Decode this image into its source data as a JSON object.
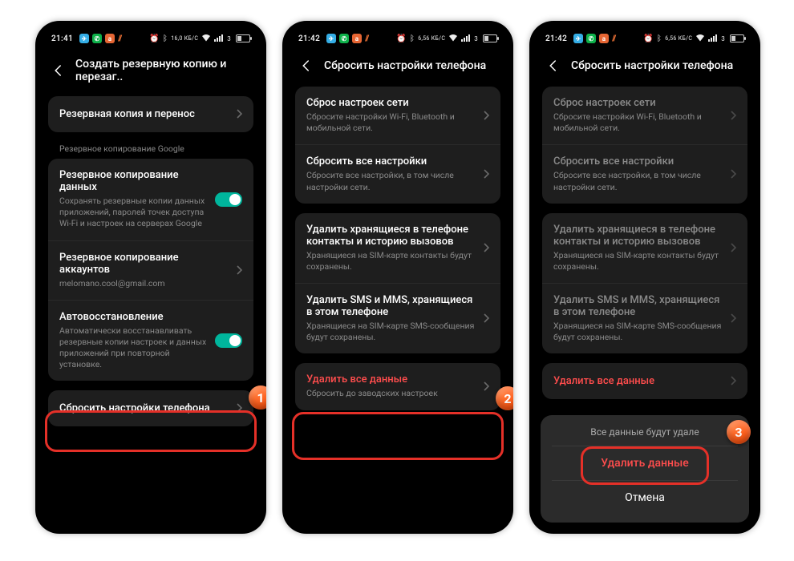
{
  "screens": {
    "s1": {
      "status": {
        "time": "21:41",
        "net": "16,0 КБ/С",
        "battery": "3"
      },
      "header": "Создать резервную копию и перезаг..",
      "row_backup_transfer": "Резервная копия и перенос",
      "section_google": "Резервное копирование Google",
      "row_data_backup": {
        "title": "Резервное копирование данных",
        "sub": "Сохранять резервные копии данных приложений, паролей точек доступа Wi-Fi и настроек на серверах Google"
      },
      "row_acct_backup": {
        "title": "Резервное копирование аккаунтов",
        "sub": "melomano.cool@gmail.com"
      },
      "row_autorestore": {
        "title": "Автовосстановление",
        "sub": "Автоматически восстанавливать резервные копии настроек и данных приложений при повторной установке."
      },
      "row_reset": "Сбросить настройки телефона",
      "badge": "1"
    },
    "s2": {
      "status": {
        "time": "21:42",
        "net": "6,56 КБ/С",
        "battery": "3"
      },
      "header": "Сбросить настройки телефона",
      "row_net": {
        "title": "Сброс настроек сети",
        "sub": "Сбросите настройки Wi-Fi, Bluetooth и мобильной сети."
      },
      "row_all": {
        "title": "Сбросить все настройки",
        "sub": "Сбросите все настройки, в том числе настройки сети."
      },
      "row_contacts": {
        "title": "Удалить хранящиеся в телефоне контакты и историю вызовов",
        "sub": "Хранящиеся на SIM-карте контакты будут сохранены."
      },
      "row_sms": {
        "title": "Удалить SMS и MMS, хранящиеся в этом телефоне",
        "sub": "Хранящиеся на SIM-карте SMS-сообщения будут сохранены."
      },
      "row_erase": {
        "title": "Удалить все данные",
        "sub": "Сбросить до заводских настроек"
      },
      "badge": "2"
    },
    "s3": {
      "status": {
        "time": "21:42",
        "net": "6,56 КБ/С",
        "battery": "3"
      },
      "header": "Сбросить настройки телефона",
      "row_erase_title": "Удалить все данные",
      "sheet": {
        "message": "Все данные будут удале",
        "confirm": "Удалить данные",
        "cancel": "Отмена"
      },
      "badge": "3"
    }
  }
}
